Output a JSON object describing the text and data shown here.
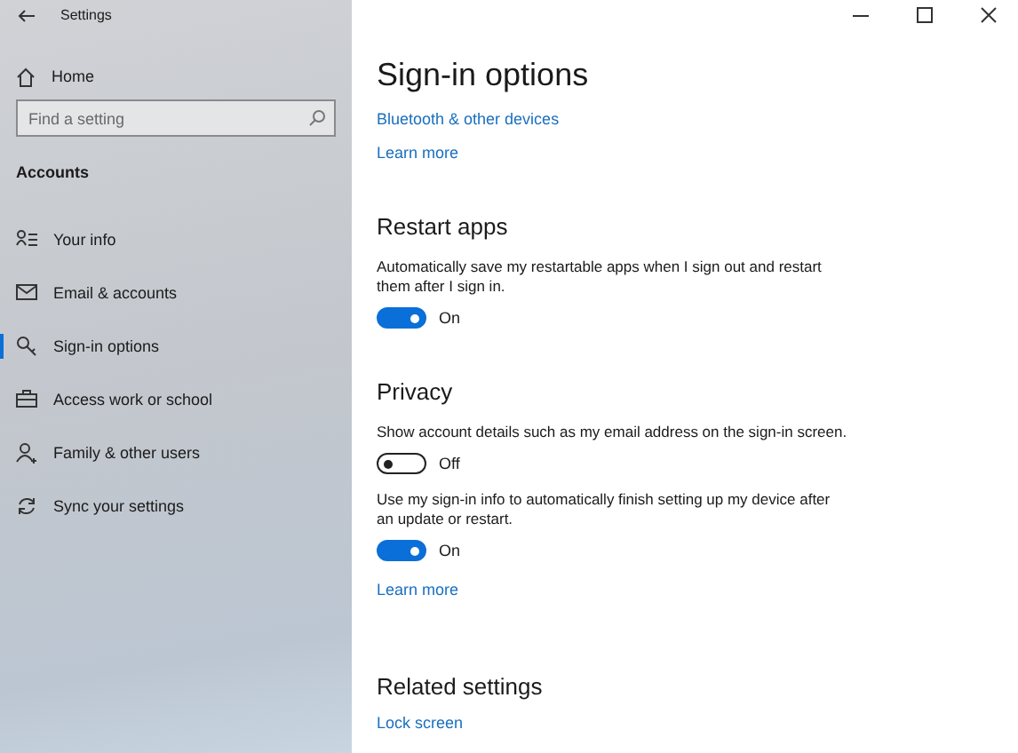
{
  "window": {
    "title": "Settings"
  },
  "sidebar": {
    "home": "Home",
    "search": {
      "placeholder": "Find a setting"
    },
    "section": "Accounts",
    "items": [
      {
        "label": "Your info",
        "selected": false
      },
      {
        "label": "Email & accounts",
        "selected": false
      },
      {
        "label": "Sign-in options",
        "selected": true
      },
      {
        "label": "Access work or school",
        "selected": false
      },
      {
        "label": "Family & other users",
        "selected": false
      },
      {
        "label": "Sync your settings",
        "selected": false
      }
    ]
  },
  "page": {
    "title": "Sign-in options",
    "links": [
      "Bluetooth & other devices",
      "Learn more"
    ],
    "sections": [
      {
        "heading": "Restart apps",
        "items": [
          {
            "kind": "text",
            "text": "Automatically save my restartable apps when I sign out and restart them after I sign in."
          },
          {
            "kind": "toggle",
            "on": true,
            "label": "On"
          }
        ]
      },
      {
        "heading": "Privacy",
        "items": [
          {
            "kind": "text",
            "text": "Show account details such as my email address on the sign-in screen."
          },
          {
            "kind": "toggle",
            "on": false,
            "label": "Off"
          },
          {
            "kind": "text",
            "text": "Use my sign-in info to automatically finish setting up my device after an update or restart."
          },
          {
            "kind": "toggle",
            "on": true,
            "label": "On"
          },
          {
            "kind": "link",
            "text": "Learn more"
          }
        ]
      },
      {
        "heading": "Related settings",
        "kind": "related",
        "items": [
          {
            "kind": "link",
            "text": "Lock screen"
          }
        ]
      }
    ]
  }
}
